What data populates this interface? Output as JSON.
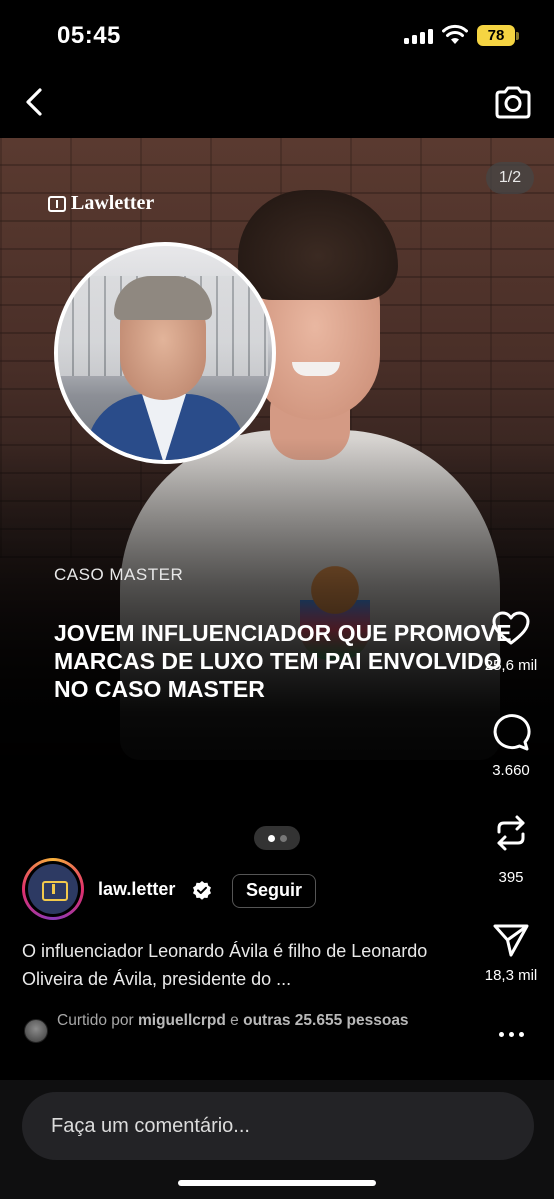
{
  "status_bar": {
    "time": "05:45",
    "battery": "78"
  },
  "post": {
    "page_counter": "1/2",
    "brand_logo": "Lawletter",
    "kicker": "CASO MASTER",
    "headline": "JOVEM INFLUENCIADOR QUE PROMOVE MARCAS DE LUXO TEM PAI ENVOLVIDO NO CASO MASTER",
    "carousel": {
      "current": 1,
      "total": 2
    }
  },
  "actions": {
    "likes": "25,6 mil",
    "comments": "3.660",
    "reposts": "395",
    "shares": "18,3 mil"
  },
  "author": {
    "username": "law.letter",
    "verified": true,
    "follow_label": "Seguir"
  },
  "caption": "O influenciador Leonardo Ávila é filho de Leonardo Oliveira de Ávila, presidente do ...",
  "liked_by": {
    "prefix": "Curtido por",
    "user": "miguellcrpd",
    "conjunction": "e",
    "others": "outras 25.655",
    "suffix": "pessoas"
  },
  "comment_bar": {
    "placeholder": "Faça um comentário..."
  },
  "icons": [
    "back-icon",
    "camera-icon",
    "heart-icon",
    "comment-icon",
    "repost-icon",
    "send-icon",
    "verified-icon",
    "more-icon",
    "signal-icon",
    "wifi-icon",
    "battery-icon"
  ]
}
